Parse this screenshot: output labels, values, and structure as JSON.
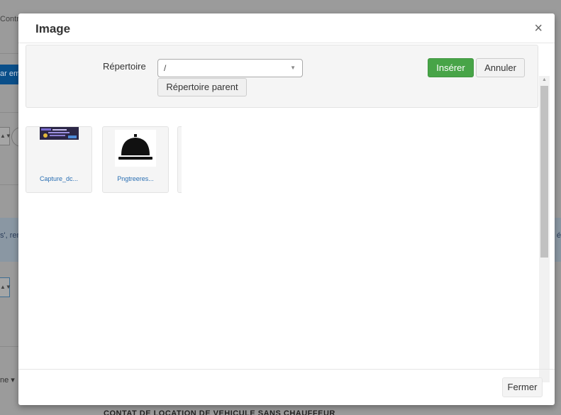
{
  "background": {
    "partial_title": "Contr",
    "partial_button": "ar em",
    "alert_text_left": "s', rer",
    "alert_text_right": "é",
    "dropdown_partial": "ne",
    "bottom_heading": "CONTAT DE LOCATION DE VEHICULE SANS CHAUFFEUR"
  },
  "modal": {
    "title": "Image",
    "close_glyph": "×",
    "toolbar": {
      "directory_label": "Répertoire",
      "directory_value": "/",
      "parent_button": "Répertoire parent",
      "insert_button": "Insérer",
      "cancel_button": "Annuler"
    },
    "files": [
      {
        "name": "Capture_dc...",
        "thumb": "screenshot-thumbnail"
      },
      {
        "name": "Pngtreeres...",
        "thumb": "service-bell-icon"
      }
    ],
    "footer": {
      "close_button": "Fermer"
    }
  },
  "colors": {
    "insert_green": "#47a447",
    "link_blue": "#2a6fb3",
    "overlay_gray": "#9b9b9b"
  }
}
